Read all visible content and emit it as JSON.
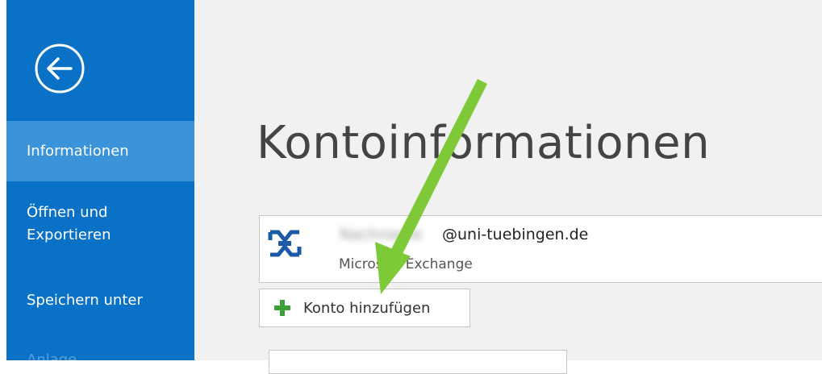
{
  "sidebar": {
    "items": [
      {
        "label": "Informationen",
        "selected": true
      },
      {
        "label": "Öffnen und Exportieren"
      },
      {
        "label": "Speichern unter"
      },
      {
        "label": "Anlage"
      }
    ]
  },
  "main": {
    "title": "Kontoinformationen",
    "account": {
      "email_user": "Nachname",
      "email_domain": "@uni-tuebingen.de",
      "type": "Microsoft Exchange"
    },
    "add_account_label": "Konto hinzufügen"
  },
  "colors": {
    "sidebar_bg": "#0a72c6",
    "selected_bg": "#3b93da",
    "plus_green": "#3aa03a",
    "arrow_green": "#7dc937",
    "exchange_blue": "#1a5aa8"
  },
  "icons": {
    "back": "back-arrow-icon",
    "account": "exchange-icon",
    "add": "plus-icon",
    "annotation": "green-arrow-annotation"
  }
}
